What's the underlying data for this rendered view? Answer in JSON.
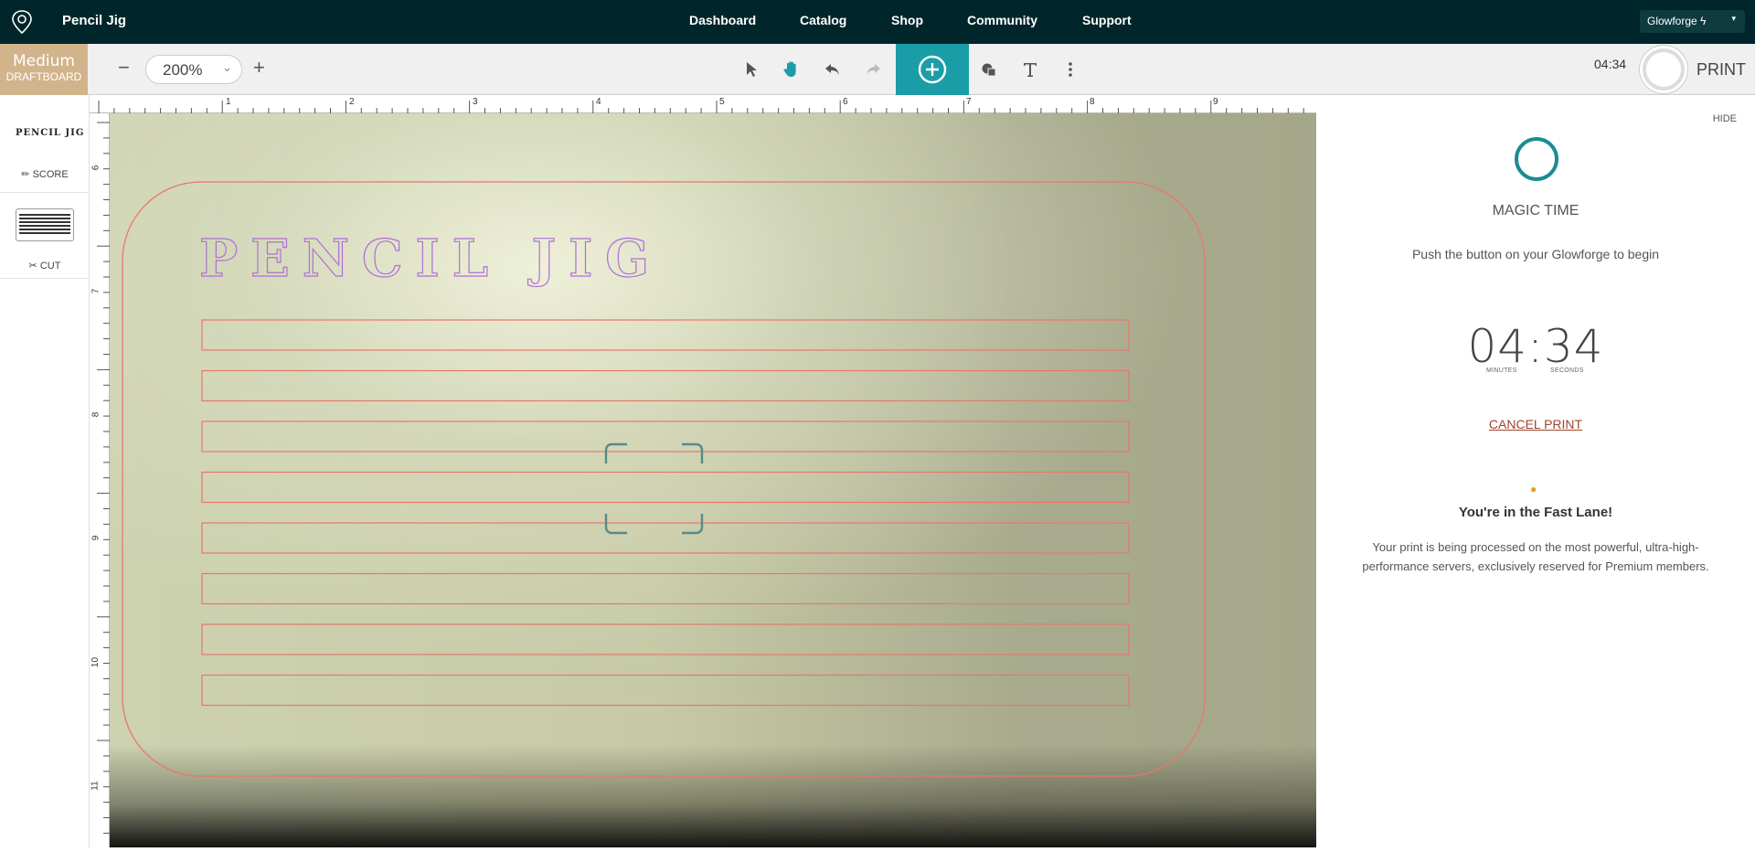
{
  "app": {
    "title": "Pencil Jig",
    "nav": [
      "Dashboard",
      "Catalog",
      "Shop",
      "Community",
      "Support"
    ],
    "account_label": "Glowforge ϟ",
    "account_caret": "▾"
  },
  "toolbar": {
    "material_name": "Medium",
    "material_type": "DRAFTBOARD",
    "zoom_value": "200%",
    "zoom_out_symbol": "−",
    "zoom_in_symbol": "+",
    "timer": "04:34",
    "print_label": "PRINT",
    "icons": [
      "pointer-icon",
      "hand-icon",
      "undo-icon",
      "redo-icon",
      "add-icon",
      "shapes-icon",
      "text-icon",
      "more-icon"
    ]
  },
  "left_panel": {
    "operations": [
      {
        "thumb_text": "PENCIL JIG",
        "label": "SCORE",
        "icon": "pencil-icon"
      },
      {
        "thumb_text": "",
        "label": "CUT",
        "icon": "scissors-icon"
      }
    ]
  },
  "rulers": {
    "top": [
      "1",
      "2",
      "3",
      "4",
      "5",
      "6",
      "7",
      "8",
      "9"
    ],
    "left": [
      "6",
      "7",
      "8",
      "9",
      "10",
      "11"
    ]
  },
  "canvas": {
    "engrave_text": "PENCIL JIG",
    "slot_count": 8,
    "colors": {
      "cut": "#e8776a",
      "score": "#b06fd6",
      "focus": "#5a8a86"
    }
  },
  "right_panel": {
    "hide_label": "HIDE",
    "status_title": "MAGIC TIME",
    "instruction": "Push the button on your Glowforge to begin",
    "timer": "04:34",
    "minutes_label": "MINUTES",
    "seconds_label": "SECONDS",
    "cancel_label": "CANCEL PRINT",
    "fast_lane_title": "You're in the Fast Lane!",
    "fast_lane_desc": "Your print is being processed on the most powerful, ultra-high-performance servers, exclusively reserved for Premium members."
  }
}
